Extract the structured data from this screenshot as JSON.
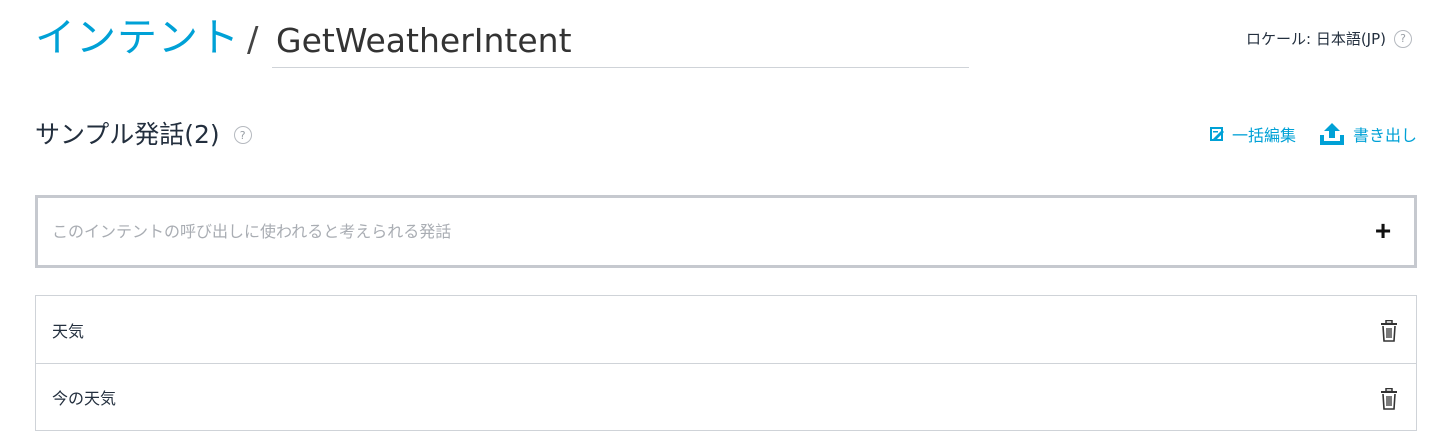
{
  "header": {
    "breadcrumb_root": "インテント",
    "separator": "/",
    "intent_name": "GetWeatherIntent",
    "locale_label": "ロケール: 日本語(JP)",
    "help_glyph": "?"
  },
  "section": {
    "title": "サンプル発話(2)",
    "help_glyph": "?",
    "bulk_edit_label": "一括編集",
    "export_label": "書き出し"
  },
  "input": {
    "placeholder": "このインテントの呼び出しに使われると考えられる発話",
    "value": "",
    "add_glyph": "+"
  },
  "utterances": [
    {
      "text": "天気"
    },
    {
      "text": "今の天気"
    }
  ],
  "icons": {
    "help": "help-circle-icon",
    "bulk_edit": "bulk-edit-icon",
    "export": "upload-icon",
    "delete": "trash-icon"
  },
  "colors": {
    "accent": "#00a1d6",
    "text": "#232f3e",
    "border": "#cfd3d8",
    "input_border": "#c6c9cf"
  }
}
